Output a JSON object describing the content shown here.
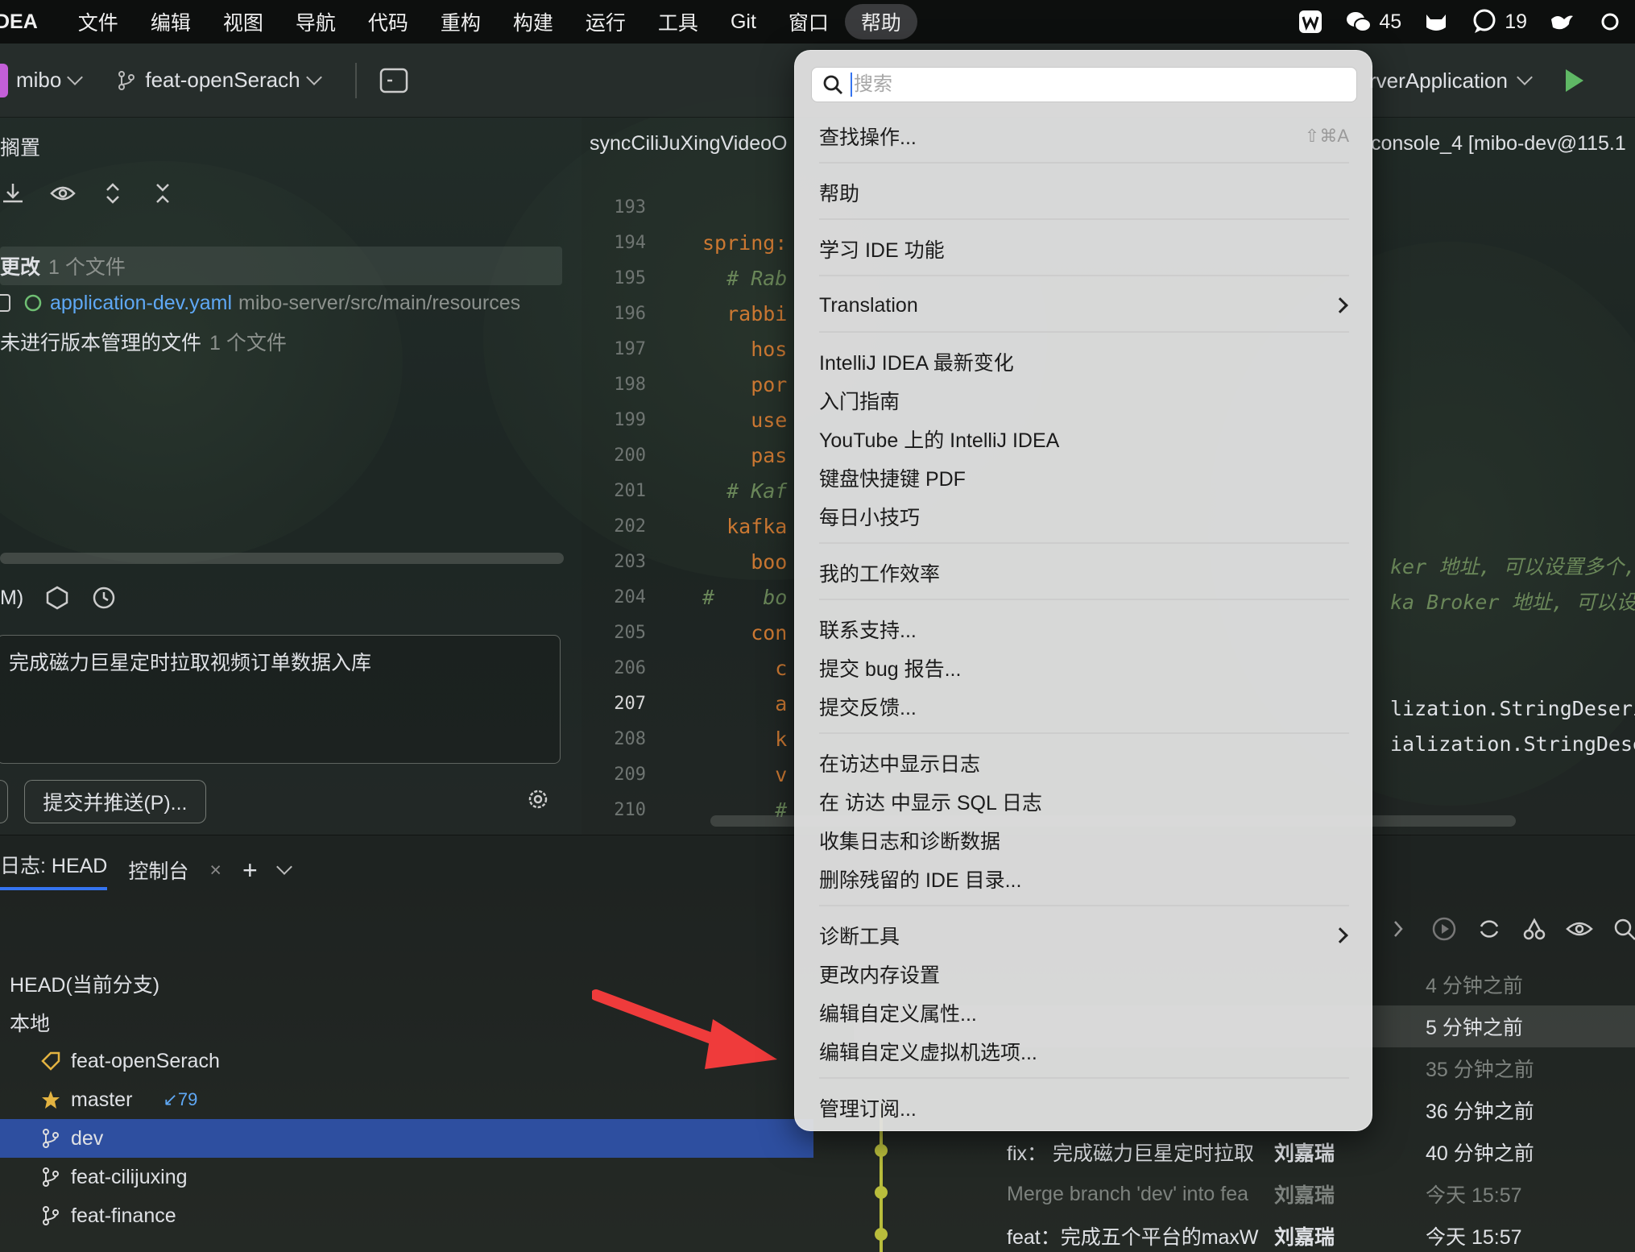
{
  "menubar": {
    "app_name": "DEA",
    "items": [
      "文件",
      "编辑",
      "视图",
      "导航",
      "代码",
      "重构",
      "构建",
      "运行",
      "工具",
      "Git",
      "窗口",
      "帮助"
    ],
    "active": "帮助",
    "tray": {
      "wechat_count": "45",
      "messages_count": "19"
    }
  },
  "toolbar": {
    "project": "mibo",
    "branch": "feat-openSerach",
    "run_config": "rverApplication"
  },
  "left_panel": {
    "title": "搁置",
    "changes_label": "更改",
    "changes_count": "1 个文件",
    "file_name": "application-dev.yaml",
    "file_path": "mibo-server/src/main/resources",
    "unversioned_label": "未进行版本管理的文件",
    "unversioned_count": "1 个文件",
    "amend_label": "M)",
    "commit_message": "完成磁力巨星定时拉取视频订单数据入库",
    "commit_button_partial": ")",
    "commit_push_button": "提交并推送(P)..."
  },
  "editor": {
    "tab_left": "syncCiliJuXingVideoO",
    "tab_right": "console_4 [mibo-dev@115.1",
    "line_numbers": [
      "193",
      "194",
      "195",
      "196",
      "197",
      "198",
      "199",
      "200",
      "201",
      "202",
      "203",
      "204",
      "205",
      "206",
      "207",
      "208",
      "209",
      "210"
    ],
    "current_line": "207",
    "code_lines": [
      "",
      "spring:",
      "  # Rab",
      "  rabbi",
      "    hos",
      "    por",
      "    use",
      "    pas",
      "  # Kaf",
      "  kafka",
      "    boo",
      "#    bo",
      "    con",
      "      c",
      "      a",
      "      k",
      "      v",
      "      #"
    ],
    "right_lines": [
      "ker 地址, 可以设置多个,",
      "ka Broker 地址, 可以设置",
      "",
      "",
      "lization.StringDeseri",
      "ialization.StringDese"
    ]
  },
  "bottom": {
    "tab_log": "日志: HEAD",
    "tab_console": "控制台",
    "tree": [
      {
        "label": "HEAD(当前分支)",
        "icon": "none"
      },
      {
        "label": "本地",
        "icon": "none"
      },
      {
        "label": "feat-openSerach",
        "icon": "tag-icon"
      },
      {
        "label": "master",
        "icon": "star-icon",
        "badge": "↙79"
      },
      {
        "label": "dev",
        "icon": "branch-icon"
      },
      {
        "label": "feat-cilijuxing",
        "icon": "branch-icon"
      },
      {
        "label": "feat-finance",
        "icon": "branch-icon"
      }
    ],
    "log": [
      {
        "msg": "",
        "author": "",
        "time": "4 分钟之前",
        "faded": true
      },
      {
        "msg": "",
        "author": "",
        "time": "5 分钟之前",
        "faded": false
      },
      {
        "msg": "",
        "author": "",
        "time": "35 分钟之前",
        "faded": true
      },
      {
        "msg": "",
        "author": "",
        "time": "36 分钟之前",
        "faded": false
      },
      {
        "msg": "fix： 完成磁力巨星定时拉取",
        "author": "刘嘉瑞",
        "time": "40 分钟之前",
        "faded": false
      },
      {
        "msg": "Merge branch 'dev' into fea",
        "author": "刘嘉瑞",
        "time": "今天 15:57",
        "faded": true
      },
      {
        "msg": "feat：完成五个平台的maxW",
        "author": "刘嘉瑞",
        "time": "今天 15:57",
        "faded": false
      }
    ]
  },
  "help_menu": {
    "search_placeholder": "搜索",
    "items": [
      {
        "label": "查找操作...",
        "shortcut": "⇧⌘A"
      },
      {
        "label": "帮助"
      },
      {
        "label": "学习 IDE 功能"
      },
      {
        "label": "Translation",
        "submenu": true
      },
      {
        "label": "IntelliJ IDEA 最新变化"
      },
      {
        "label": "入门指南"
      },
      {
        "label": "YouTube 上的 IntelliJ IDEA"
      },
      {
        "label": "键盘快捷键 PDF"
      },
      {
        "label": "每日小技巧"
      },
      {
        "label": "我的工作效率"
      },
      {
        "label": "联系支持..."
      },
      {
        "label": "提交 bug 报告..."
      },
      {
        "label": "提交反馈..."
      },
      {
        "label": "在访达中显示日志"
      },
      {
        "label": "在 访达 中显示 SQL 日志"
      },
      {
        "label": "收集日志和诊断数据"
      },
      {
        "label": "删除残留的 IDE 目录..."
      },
      {
        "label": "诊断工具",
        "submenu": true
      },
      {
        "label": "更改内存设置"
      },
      {
        "label": "编辑自定义属性..."
      },
      {
        "label": "编辑自定义虚拟机选项..."
      },
      {
        "label": "管理订阅..."
      }
    ]
  },
  "colors": {
    "accent": "#3574f0",
    "selection": "#2e4fa0",
    "arrow": "#ef3b3b",
    "graph": "#b9bd3c"
  }
}
